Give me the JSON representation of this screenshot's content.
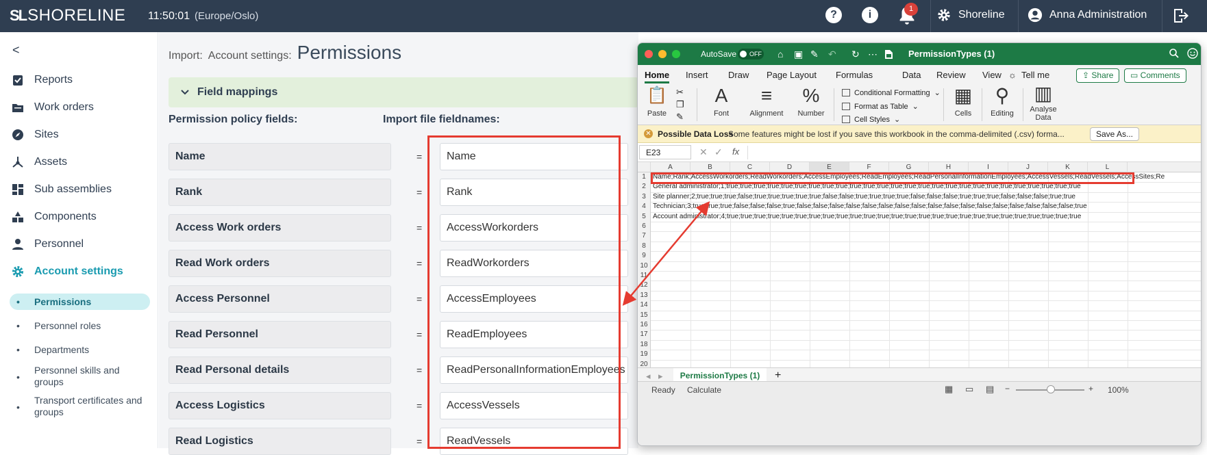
{
  "topbar": {
    "logo_mark": "SL",
    "logo_word": "SHORELINE",
    "time": "11:50:01",
    "timezone": "(Europe/Oslo)",
    "help_glyph": "?",
    "info_glyph": "i",
    "notification_count": "1",
    "org": "Shoreline",
    "user": "Anna Administration"
  },
  "sidebar": {
    "back_glyph": "<",
    "items": [
      {
        "label": "Reports",
        "icon": "reports-icon"
      },
      {
        "label": "Work orders",
        "icon": "work-orders-icon"
      },
      {
        "label": "Sites",
        "icon": "compass-icon"
      },
      {
        "label": "Assets",
        "icon": "assets-icon"
      },
      {
        "label": "Sub assemblies",
        "icon": "grid-icon"
      },
      {
        "label": "Components",
        "icon": "components-icon"
      },
      {
        "label": "Personnel",
        "icon": "person-icon"
      },
      {
        "label": "Account settings",
        "icon": "gear-icon"
      }
    ],
    "subitems": [
      {
        "label": "Permissions"
      },
      {
        "label": "Personnel roles"
      },
      {
        "label": "Departments"
      },
      {
        "label": "Personnel skills and groups"
      },
      {
        "label": "Transport certificates and groups"
      }
    ]
  },
  "main": {
    "crumb1": "Import:",
    "crumb2": "Account settings:",
    "title": "Permissions",
    "field_mappings": "Field mappings",
    "left_header": "Permission policy fields:",
    "right_header": "Import file fieldnames:",
    "eq": "=",
    "rows": [
      {
        "label": "Name",
        "value": "Name"
      },
      {
        "label": "Rank",
        "value": "Rank"
      },
      {
        "label": "Access Work orders",
        "value": "AccessWorkorders"
      },
      {
        "label": "Read Work orders",
        "value": "ReadWorkorders"
      },
      {
        "label": "Access Personnel",
        "value": "AccessEmployees"
      },
      {
        "label": "Read Personnel",
        "value": "ReadEmployees"
      },
      {
        "label": "Read Personal details",
        "value": "ReadPersonalInformationEmployees"
      },
      {
        "label": "Access Logistics",
        "value": "AccessVessels"
      },
      {
        "label": "Read Logistics",
        "value": "ReadVessels"
      }
    ]
  },
  "excel": {
    "autosave": "AutoSave",
    "toggle": "OFF",
    "filename": "PermissionTypes (1)",
    "tabs": [
      "Home",
      "Insert",
      "Draw",
      "Page Layout",
      "Formulas",
      "Data",
      "Review",
      "View",
      "Tell me"
    ],
    "share": "Share",
    "comments": "Comments",
    "ribbon": {
      "paste": "Paste",
      "font": "Font",
      "alignment": "Alignment",
      "number": "Number",
      "cond": "Conditional Formatting",
      "fmt_table": "Format as Table",
      "cell_styles": "Cell Styles",
      "cells": "Cells",
      "editing": "Editing",
      "analyse1": "Analyse",
      "analyse2": "Data",
      "number_glyph": "%",
      "font_glyph": "A"
    },
    "message": {
      "title": "Possible Data Loss",
      "text": "Some features might be lost if you save this workbook in the comma-delimited (.csv) forma...",
      "button": "Save As..."
    },
    "namebox": "E23",
    "fx": "fx",
    "columns": [
      "A",
      "B",
      "C",
      "D",
      "E",
      "F",
      "G",
      "H",
      "I",
      "J",
      "K",
      "L"
    ],
    "rows": [
      "Name;Rank;AccessWorkorders;ReadWorkorders;AccessEmployees;ReadEmployees;ReadPersonalInformationEmployees;AccessVessels;ReadVessels;AccessSites;Re",
      "General administrator;1;true;true;true;true;true;true;true;true;true;true;true;true;true;true;true;true;true;true;true;true;true;true;true;true;true;true",
      "Site planner;2;true;true;true;false;true;true;true;true;true;false;false;true;true;true;true;false;false;false;true;true;true;false;false;false;true;true",
      "Technician;3;true;true;true;false;false;false;true;false;false;false;false;false;false;false;false;false;false;false;false;false;false;false;false;false;true",
      "Account administrator;4;true;true;true;true;true;true;true;true;true;true;true;true;true;true;true;true;true;true;true;true;true;true;true;true;true;true"
    ],
    "row_numbers": [
      "1",
      "2",
      "3",
      "4",
      "5",
      "6",
      "7",
      "8",
      "9",
      "10",
      "11",
      "12",
      "13",
      "14",
      "15",
      "16",
      "17",
      "18",
      "19",
      "20"
    ],
    "sheet_tab": "PermissionTypes (1)",
    "add_sheet": "+",
    "status_ready": "Ready",
    "status_calc": "Calculate",
    "zoom": "100%"
  }
}
